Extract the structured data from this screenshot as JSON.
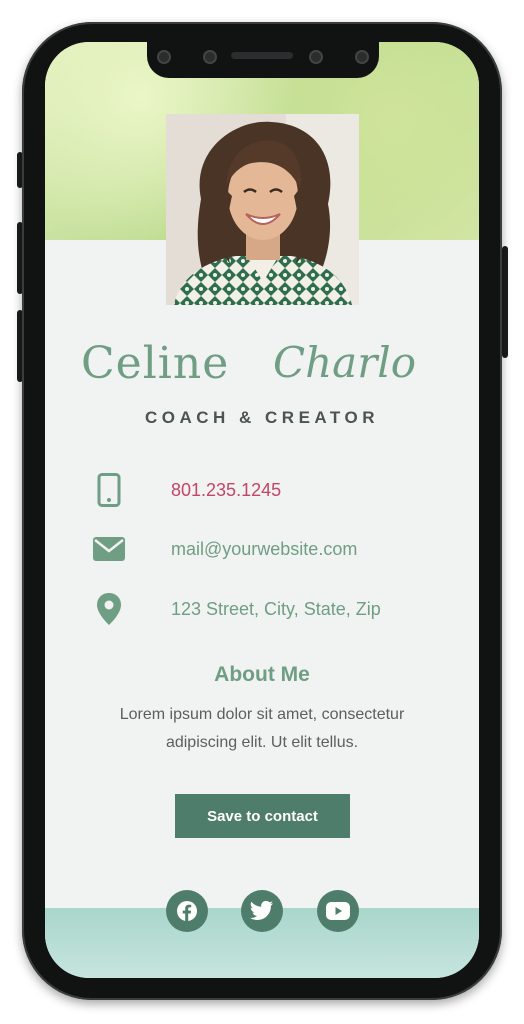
{
  "profile": {
    "first_name": "Celine",
    "last_name": "Charlo",
    "tagline": "COACH & CREATOR"
  },
  "contacts": [
    {
      "icon": "mobile-phone-icon",
      "text": "801.235.1245"
    },
    {
      "icon": "envelope-icon",
      "text": "mail@yourwebsite.com"
    },
    {
      "icon": "map-pin-icon",
      "text": "123 Street, City, State, Zip"
    }
  ],
  "about": {
    "title": "About Me",
    "body": "Lorem ipsum dolor sit amet, consectetur adipiscing elit. Ut elit tellus."
  },
  "actions": {
    "save_label": "Save to contact"
  },
  "social": [
    {
      "icon": "facebook-icon"
    },
    {
      "icon": "twitter-icon"
    },
    {
      "icon": "youtube-icon"
    }
  ],
  "colors": {
    "accent": "#6f9e84",
    "button": "#4f7d6c",
    "phone_text": "#c2456a",
    "body_text": "#5b5f5e",
    "screen_bg": "#f1f2f2"
  }
}
